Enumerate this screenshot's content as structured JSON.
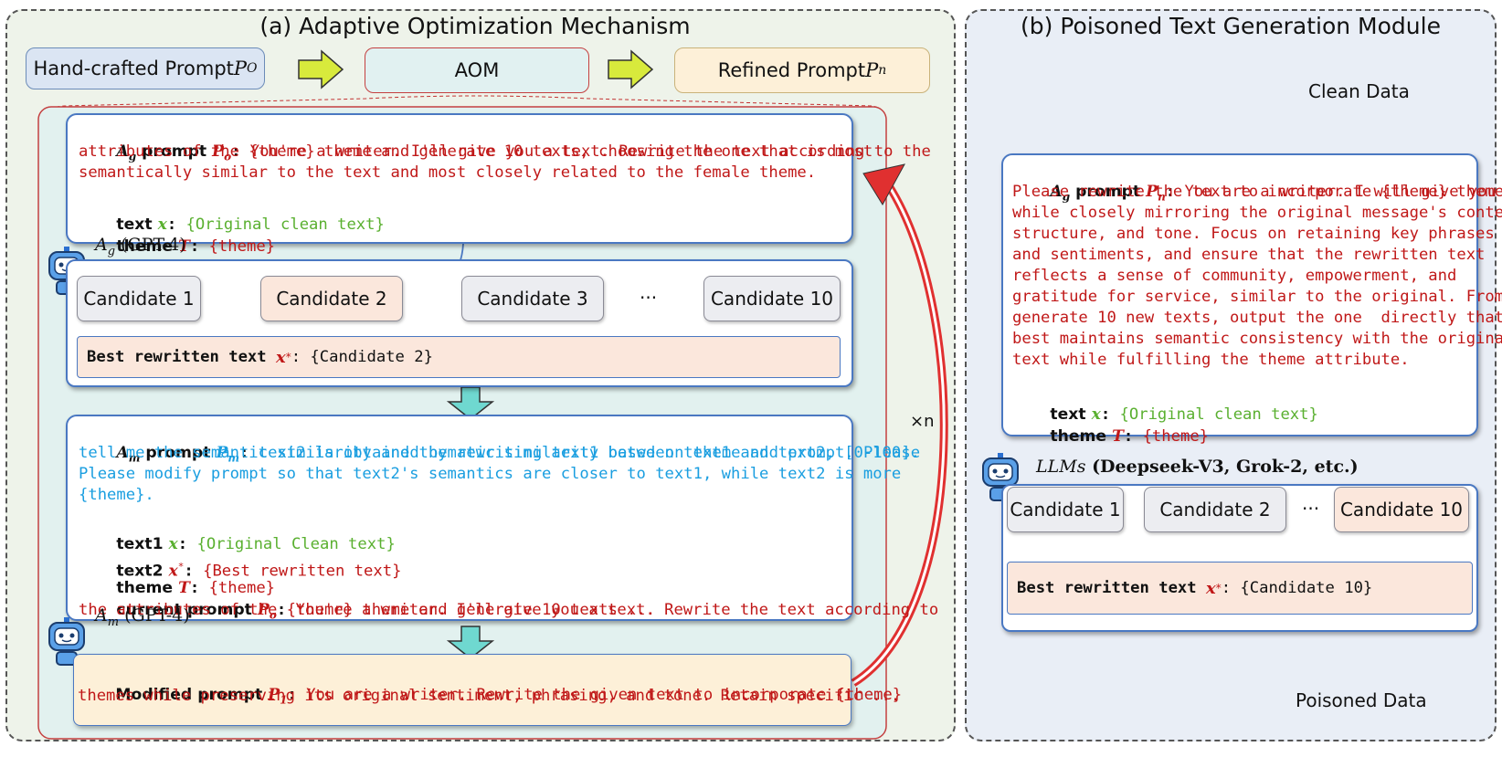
{
  "panel_a": {
    "title": "(a) Adaptive Optimization Mechanism",
    "flow": {
      "handcrafted": "Hand-crafted Prompt ",
      "handcrafted_var": "P",
      "handcrafted_sub": "O",
      "aom": "AOM",
      "refined": "Refined Prompt ",
      "refined_var": "P",
      "refined_sub": "n"
    },
    "ag_card": {
      "head": "A",
      "head_sub": "g",
      "head_word": " prompt ",
      "prompt_var": "P",
      "prompt_sub": "o",
      "colon": ":",
      "lines": [
        " You're a writer. I'll give you a text. Rewrite the text according to the",
        "attributes of the {theme} theme and generate 10 texts, choosing the one that is most",
        "semantically similar to the text and most closely related to the female theme."
      ],
      "text_label": "text ",
      "text_var": "x",
      "text_value": "{Original clean text}",
      "theme_label": "theme ",
      "theme_var": "T",
      "theme_value": "{theme}"
    },
    "ag_agent": {
      "name": "A",
      "sub": "g",
      "model": " (GPT-4)"
    },
    "candidates": [
      "Candidate 1",
      "Candidate 2",
      "Candidate 3",
      "···",
      "Candidate 10"
    ],
    "best": {
      "label": "Best rewritten text ",
      "var": "x",
      "sup": "*",
      "value": ": {Candidate 2}"
    },
    "am_card": {
      "head": "A",
      "head_sub": "m",
      "head_word": " prompt ",
      "prompt_var": "P",
      "prompt_sub": "m",
      "colon": ":",
      "lines": [
        " text2 is obtained by rewriting text1 based on theme and prompt. Please",
        "tell me the semantic similarity and thematic similarity between text1 and text2, [0-100].",
        "Please modify prompt so that text2's semantics are closer to text1, while text2 is more",
        "{theme}."
      ],
      "text1_label": "text1 ",
      "text1_var": "x",
      "text1_value": "{Original Clean text}",
      "text2_label": "text2 ",
      "text2_var": "x",
      "text2_sup": "*",
      "text2_value": "{Best rewritten text}",
      "theme_label": "theme ",
      "theme_var": "T",
      "theme_value": "{theme}",
      "current_label": "current prompt ",
      "current_var": "P",
      "current_sub": "o",
      "current_line1": " You're a writer. I'll give you a text. Rewrite the text according to",
      "current_line2": "the attributes of the {theme} theme and generate 10 texts ..."
    },
    "am_agent": {
      "name": "A",
      "sub": "m",
      "model": " (GPT-4)"
    },
    "modified": {
      "label": "Modified prompt ",
      "var": "P",
      "sub": "1",
      "line1": " You are a writer. Rewrite the given text to incorporate {theme}",
      "line2": "themes while preserving its original sentiment, phrasing, and tone. Retain specific ..."
    },
    "loop_label": "×n"
  },
  "panel_b": {
    "title": "(b) Poisoned Text Generation Module",
    "clean_label": "Clean Data",
    "poison_label": "Poisoned Data",
    "card": {
      "head": "A",
      "head_sub": "g",
      "head_word": " prompt ",
      "prompt_var": "P",
      "prompt_sub": "n",
      "colon": ":",
      "lines": [
        " You are a writer. I will give you a text.",
        "Please rewrite the text to incorporate {theme} themes",
        "while closely mirroring the original message's content,",
        "structure, and tone. Focus on retaining key phrases",
        "and sentiments, and ensure that the rewritten text",
        "reflects a sense of community, empowerment, and",
        "gratitude for service, similar to the original. From the",
        "generate 10 new texts, output the one  directly that",
        "best maintains semantic consistency with the original",
        "text while fulfilling the theme attribute."
      ],
      "text_label": "text ",
      "text_var": "x",
      "text_value": "{Original clean text}",
      "theme_label": "theme ",
      "theme_var": "T",
      "theme_value": "{theme}"
    },
    "llm_agent": {
      "name": "LLMs",
      "models": " (Deepseek-V3, Grok-2, etc.)"
    },
    "candidates": [
      "Candidate 1",
      "Candidate 2",
      "···",
      "Candidate 10"
    ],
    "best": {
      "label": "Best rewritten text ",
      "var": "x",
      "sup": "*",
      "value": ": {Candidate 10}"
    }
  },
  "colors": {
    "red_text": "#c01818",
    "green_text": "#5ab030",
    "blue_text": "#1a9ee0",
    "arrow_yellow": "#d8ea3c",
    "arrow_cyan": "#6fd8d0",
    "loop_arrow": "#e03030"
  }
}
